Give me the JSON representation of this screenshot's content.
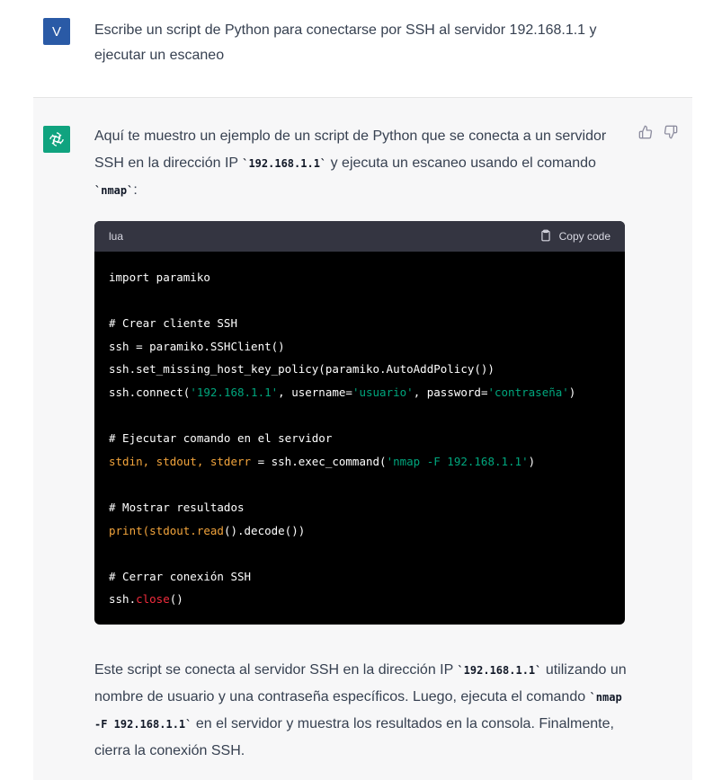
{
  "user_message": {
    "avatar_letter": "V",
    "text": "Escribe un script de Python para conectarse por SSH al servidor 192.168.1.1 y ejecutar un escaneo"
  },
  "assistant_message": {
    "intro": {
      "part1": "Aquí te muestro un ejemplo de un script de Python que se conecta a un servidor SSH en la dirección IP ",
      "code1": "`192.168.1.1`",
      "part2": " y ejecuta un escaneo usando el comando ",
      "code2": "`nmap`",
      "part3": ":"
    },
    "code_block": {
      "language": "lua",
      "copy_label": "Copy code",
      "lines": [
        "import paramiko",
        "",
        "# Crear cliente SSH",
        "ssh = paramiko.SSHClient()",
        "ssh.set_missing_host_key_policy(paramiko.AutoAddPolicy())",
        "ssh.connect('192.168.1.1', username='usuario', password='contraseña')",
        "",
        "# Ejecutar comando en el servidor",
        "stdin, stdout, stderr = ssh.exec_command('nmap -F 192.168.1.1')",
        "",
        "# Mostrar resultados",
        "print(stdout.read().decode())",
        "",
        "# Cerrar conexión SSH",
        "ssh.close()"
      ]
    },
    "outro": {
      "part1": "Este script se conecta al servidor SSH en la dirección IP ",
      "code1": "`192.168.1.1`",
      "part2": " utilizando un nombre de usuario y una contraseña específicos. Luego, ejecuta el comando ",
      "code2": "`nmap -F 192.168.1.1`",
      "part3": " en el servidor y muestra los resultados en la consola. Finalmente, cierra la conexión SSH."
    }
  },
  "colors": {
    "user_avatar": "#2a5aa6",
    "assistant_avatar": "#10a37f",
    "code_bg": "#000000",
    "code_header_bg": "#343541",
    "string_token": "#00a67d"
  }
}
